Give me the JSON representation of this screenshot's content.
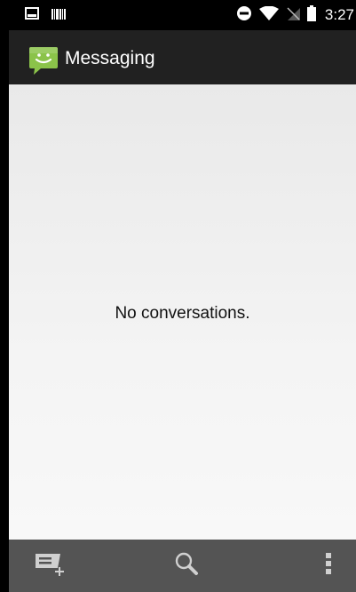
{
  "status_bar": {
    "time": "3:27",
    "icons": [
      "image-notification-icon",
      "barcode-notification-icon",
      "do-not-disturb-icon",
      "wifi-icon",
      "no-sim-icon",
      "battery-icon"
    ]
  },
  "action_bar": {
    "app_icon": "messaging-app-icon",
    "title": "Messaging"
  },
  "content": {
    "empty_message": "No conversations."
  },
  "bottom_bar": {
    "buttons": [
      "compose-new-message-icon",
      "search-icon",
      "overflow-menu-icon"
    ]
  },
  "colors": {
    "status_bar_bg": "#000000",
    "action_bar_bg": "#212121",
    "content_bg": "#f0f0f0",
    "bottom_bar_bg": "#545454",
    "app_icon_green": "#8bc34a"
  }
}
